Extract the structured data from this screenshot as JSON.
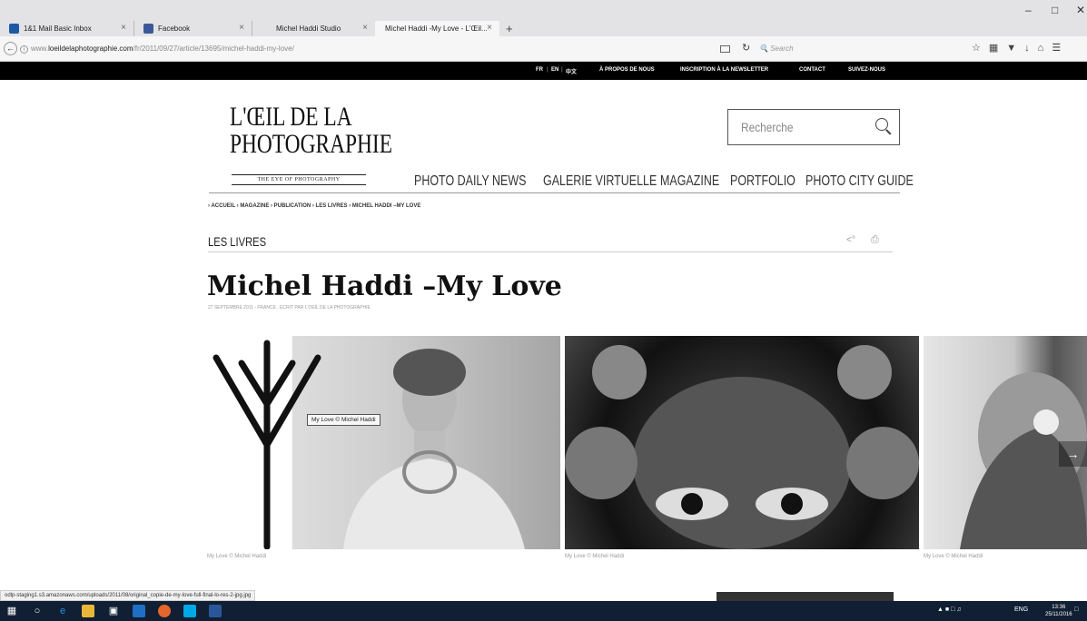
{
  "browser": {
    "tabs": [
      {
        "title": "1&1 Mail Basic Inbox",
        "color": "#1c5aa6"
      },
      {
        "title": "Facebook",
        "color": "#3b5998"
      },
      {
        "title": "Michel Haddi Studio",
        "color": "#cccccc"
      },
      {
        "title": "Michel Haddi -My Love - L'Œil...",
        "color": "#cccccc"
      }
    ],
    "new_tab": "+",
    "tab_close": "×",
    "window_controls": {
      "minimize": "–",
      "maximize": "□",
      "close": "✕"
    },
    "url_prefix": "www.",
    "url_host": "loeildelaphotographie.com",
    "url_path": "/fr/2011/09/27/article/13695/michel-haddi-my-love/",
    "search_placeholder": "Search",
    "status_url": "odlp-staging1.s3.amazonaws.com/uploads/2011/08/original_copie-de-my-love-full-final-lo-res-2-jpg.jpg"
  },
  "site": {
    "top_links": {
      "fr": "FR",
      "en": "EN",
      "zh": "中文",
      "about": "À PROPOS DE NOUS",
      "newsletter": "INSCRIPTION À LA NEWSLETTER",
      "contact": "CONTACT",
      "follow": "SUIVEZ-NOUS"
    },
    "logo_line1": "L'ŒIL DE LA",
    "logo_line2": "PHOTOGRAPHIE",
    "logo_tagline": "THE EYE OF PHOTOGRAPHY",
    "search_placeholder": "Recherche",
    "nav": [
      "PHOTO DAILY NEWS",
      "GALERIE VIRTUELLE",
      "MAGAZINE",
      "PORTFOLIO",
      "PHOTO CITY GUIDE"
    ],
    "breadcrumb": "›  ACCUEIL  ›  MAGAZINE  ›  PUBLICATION  ›  LES LIVRES  ›  MICHEL HADDI –MY LOVE",
    "section": "LES LIVRES",
    "article_title": "Michel Haddi –My Love",
    "article_meta": "27 SEPTEMBRE 2011 - FRANCE , ECRIT PAR L'OEIL DE LA PHOTOGRAPHIE",
    "tooltip": "My Love © Michel Haddi",
    "captions": [
      "My Love © Michel Haddi",
      "My Love © Michel Haddi",
      "My Love © Michel Haddi"
    ]
  },
  "taskbar": {
    "lang": "ENG",
    "time": "13:36",
    "date": "25/11/2016"
  }
}
